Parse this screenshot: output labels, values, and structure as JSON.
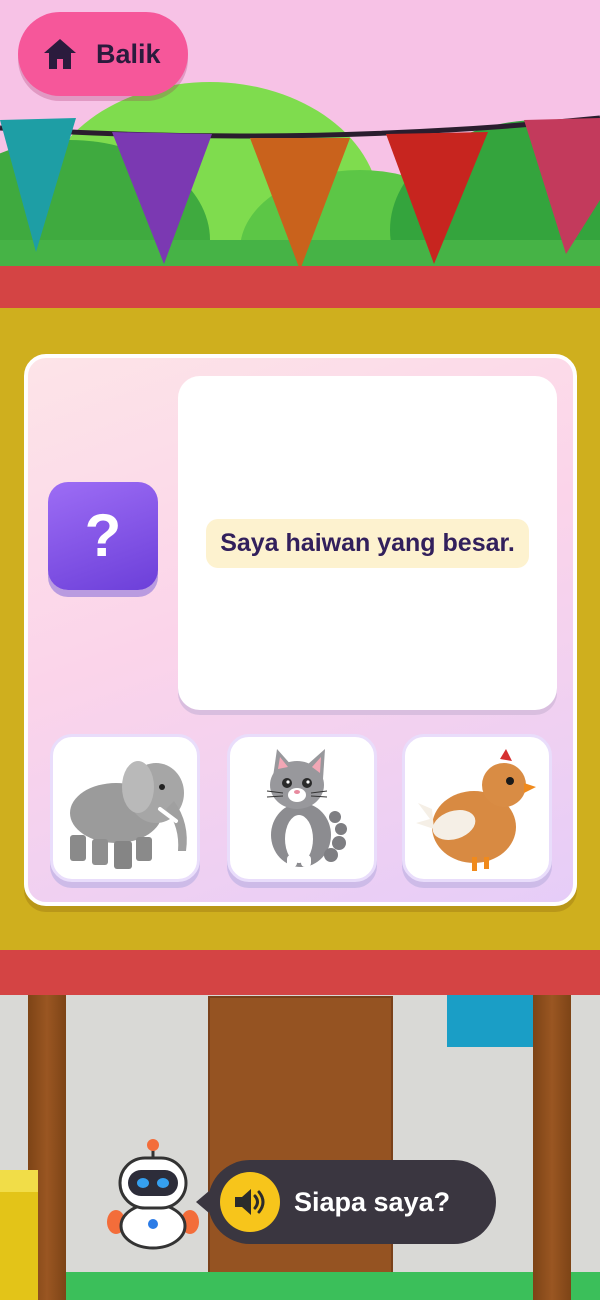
{
  "nav": {
    "back_label": "Balik",
    "back_icon": "home-icon"
  },
  "question": {
    "badge_symbol": "?",
    "text": "Saya haiwan yang besar."
  },
  "options": [
    {
      "animal": "elephant",
      "icon": "elephant-icon"
    },
    {
      "animal": "cat",
      "icon": "cat-icon"
    },
    {
      "animal": "chicken",
      "icon": "chicken-icon"
    }
  ],
  "prompt": {
    "text": "Siapa saya?",
    "speaker_icon": "speaker-icon"
  },
  "colors": {
    "sky": "#f7c2e6",
    "accent_pink": "#f6579a",
    "board_yellow": "#cfaf1e",
    "red_strip": "#d44444",
    "badge_purple": "#7d4fe6",
    "question_text": "#32205c",
    "bubble_dark": "#3a3640",
    "speaker_yellow": "#f7c51b"
  }
}
